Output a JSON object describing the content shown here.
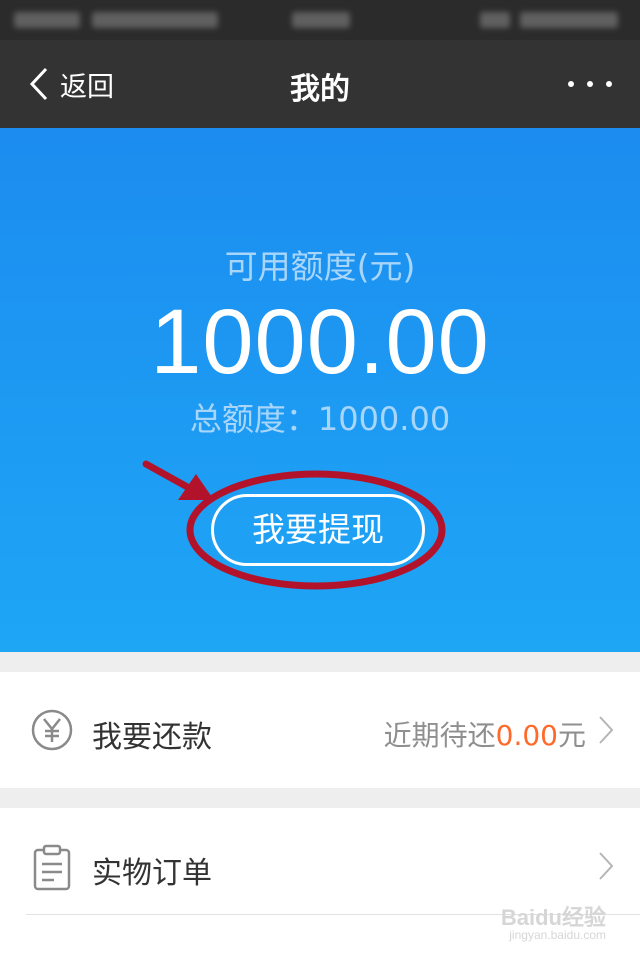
{
  "nav": {
    "back_label": "返回",
    "title": "我的"
  },
  "credit": {
    "label": "可用额度(元)",
    "amount": "1000.00",
    "total_label": "总额度：",
    "total_amount": "1000.00",
    "withdraw_button": "我要提现"
  },
  "repay": {
    "label": "我要还款",
    "status_prefix": "近期待还",
    "status_amount": "0.00",
    "status_unit": "元"
  },
  "orders": {
    "label": "实物订单"
  },
  "watermark": {
    "brand": "Baidu经验",
    "url": "jingyan.baidu.com"
  },
  "colors": {
    "accent_orange": "#ff6a2a",
    "hero_blue": "#1c8cf0",
    "annotation_red": "#b3132a"
  }
}
